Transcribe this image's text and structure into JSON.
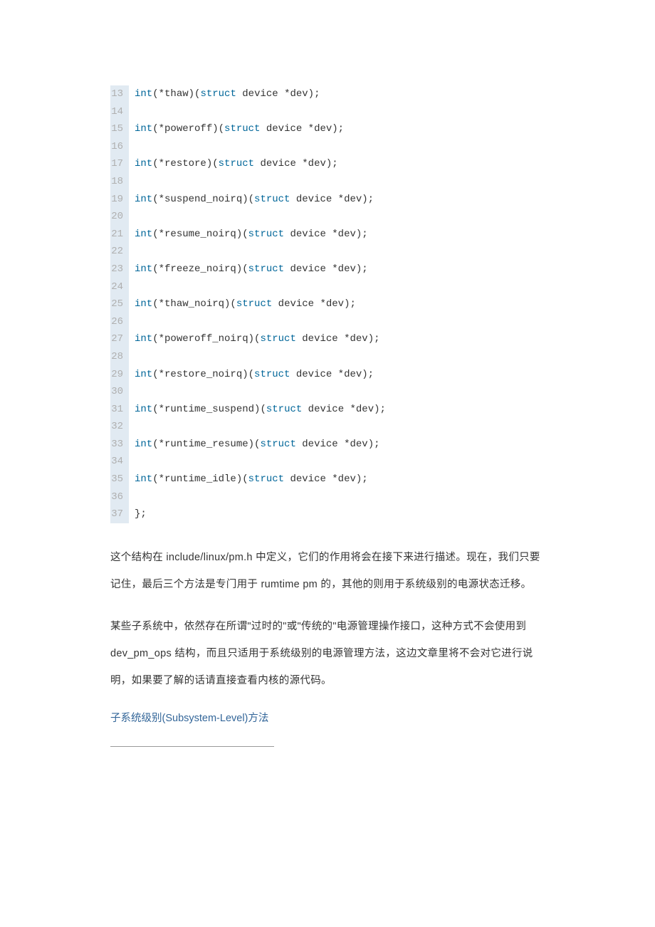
{
  "code": {
    "lines": [
      {
        "n": "13",
        "t": [
          [
            "kw",
            "int"
          ],
          [
            "plain",
            "(*thaw)("
          ],
          [
            "kw",
            "struct"
          ],
          [
            "plain",
            " device *dev);"
          ]
        ]
      },
      {
        "n": "14",
        "t": []
      },
      {
        "n": "15",
        "t": [
          [
            "kw",
            "int"
          ],
          [
            "plain",
            "(*poweroff)("
          ],
          [
            "kw",
            "struct"
          ],
          [
            "plain",
            " device *dev);"
          ]
        ]
      },
      {
        "n": "16",
        "t": []
      },
      {
        "n": "17",
        "t": [
          [
            "kw",
            "int"
          ],
          [
            "plain",
            "(*restore)("
          ],
          [
            "kw",
            "struct"
          ],
          [
            "plain",
            " device *dev);"
          ]
        ]
      },
      {
        "n": "18",
        "t": []
      },
      {
        "n": "19",
        "t": [
          [
            "kw",
            "int"
          ],
          [
            "plain",
            "(*suspend_noirq)("
          ],
          [
            "kw",
            "struct"
          ],
          [
            "plain",
            " device *dev);"
          ]
        ]
      },
      {
        "n": "20",
        "t": []
      },
      {
        "n": "21",
        "t": [
          [
            "kw",
            "int"
          ],
          [
            "plain",
            "(*resume_noirq)("
          ],
          [
            "kw",
            "struct"
          ],
          [
            "plain",
            " device *dev);"
          ]
        ]
      },
      {
        "n": "22",
        "t": []
      },
      {
        "n": "23",
        "t": [
          [
            "kw",
            "int"
          ],
          [
            "plain",
            "(*freeze_noirq)("
          ],
          [
            "kw",
            "struct"
          ],
          [
            "plain",
            " device *dev);"
          ]
        ]
      },
      {
        "n": "24",
        "t": []
      },
      {
        "n": "25",
        "t": [
          [
            "kw",
            "int"
          ],
          [
            "plain",
            "(*thaw_noirq)("
          ],
          [
            "kw",
            "struct"
          ],
          [
            "plain",
            " device *dev);"
          ]
        ]
      },
      {
        "n": "26",
        "t": []
      },
      {
        "n": "27",
        "t": [
          [
            "kw",
            "int"
          ],
          [
            "plain",
            "(*poweroff_noirq)("
          ],
          [
            "kw",
            "struct"
          ],
          [
            "plain",
            " device *dev);"
          ]
        ]
      },
      {
        "n": "28",
        "t": []
      },
      {
        "n": "29",
        "t": [
          [
            "kw",
            "int"
          ],
          [
            "plain",
            "(*restore_noirq)("
          ],
          [
            "kw",
            "struct"
          ],
          [
            "plain",
            " device *dev);"
          ]
        ]
      },
      {
        "n": "30",
        "t": []
      },
      {
        "n": "31",
        "t": [
          [
            "kw",
            "int"
          ],
          [
            "plain",
            "(*runtime_suspend)("
          ],
          [
            "kw",
            "struct"
          ],
          [
            "plain",
            " device *dev);"
          ]
        ]
      },
      {
        "n": "32",
        "t": []
      },
      {
        "n": "33",
        "t": [
          [
            "kw",
            "int"
          ],
          [
            "plain",
            "(*runtime_resume)("
          ],
          [
            "kw",
            "struct"
          ],
          [
            "plain",
            " device *dev);"
          ]
        ]
      },
      {
        "n": "34",
        "t": []
      },
      {
        "n": "35",
        "t": [
          [
            "kw",
            "int"
          ],
          [
            "plain",
            "(*runtime_idle)("
          ],
          [
            "kw",
            "struct"
          ],
          [
            "plain",
            " device *dev);"
          ]
        ]
      },
      {
        "n": "36",
        "t": []
      },
      {
        "n": "37",
        "t": [
          [
            "plain",
            "};"
          ]
        ]
      }
    ]
  },
  "para1": "这个结构在 include/linux/pm.h 中定义，它们的作用将会在接下来进行描述。现在，我们只要记住，最后三个方法是专门用于 rumtime pm 的，其他的则用于系统级别的电源状态迁移。",
  "para2": "某些子系统中，依然存在所谓\"过时的\"或\"传统的\"电源管理操作接口，这种方式不会使用到 dev_pm_ops 结构，而且只适用于系统级别的电源管理方法，这边文章里将不会对它进行说明，如果要了解的话请直接查看内核的源代码。",
  "heading": "子系统级别(Subsystem-Level)方法"
}
